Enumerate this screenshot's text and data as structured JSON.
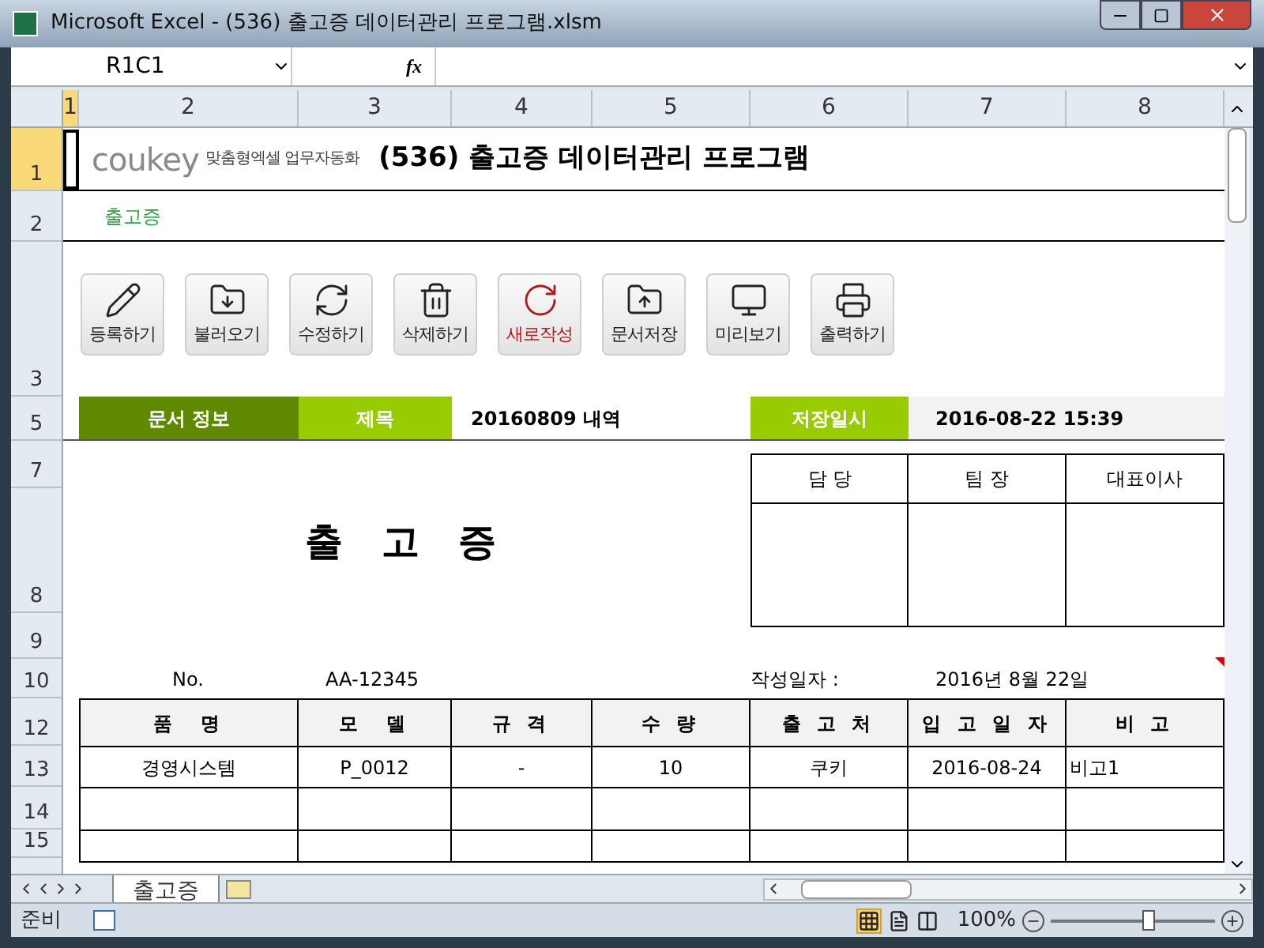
{
  "window": {
    "title": "Microsoft Excel - (536) 출고증 데이터관리 프로그램.xlsm"
  },
  "name_box": "R1C1",
  "formula_label": "fx",
  "column_headers": [
    "1",
    "2",
    "3",
    "4",
    "5",
    "6",
    "7",
    "8"
  ],
  "row_headers": [
    "1",
    "2",
    "3",
    "5",
    "7",
    "8",
    "9",
    "10",
    "12",
    "13",
    "14",
    "15"
  ],
  "header": {
    "brand": "coukey",
    "tagline": "맞춤형엑셀 업무자동화",
    "title": "(536) 출고증 데이터관리 프로그램",
    "subtitle": "출고증"
  },
  "buttons": [
    {
      "label": "등록하기",
      "highlighted": false
    },
    {
      "label": "불러오기",
      "highlighted": false
    },
    {
      "label": "수정하기",
      "highlighted": false
    },
    {
      "label": "삭제하기",
      "highlighted": false
    },
    {
      "label": "새로작성",
      "highlighted": true
    },
    {
      "label": "문서저장",
      "highlighted": false
    },
    {
      "label": "미리보기",
      "highlighted": false
    },
    {
      "label": "출력하기",
      "highlighted": false
    }
  ],
  "info_bar": {
    "section": "문서 정보",
    "title_label": "제목",
    "title_value": "20160809 내역",
    "saved_label": "저장일시",
    "saved_value": "2016-08-22 15:39"
  },
  "form": {
    "heading": "출 고 증",
    "approvals": [
      "담 당",
      "팀 장",
      "대표이사"
    ],
    "no_label": "No.",
    "no_value": "AA-12345",
    "date_label": "작성일자 :",
    "date_value": "2016년 8월 22일"
  },
  "table": {
    "columns": [
      "품　명",
      "모　델",
      "규 격",
      "수 량",
      "출 고 처",
      "입 고 일 자",
      "비 고"
    ],
    "rows": [
      [
        "경영시스템",
        "P_0012",
        "-",
        "10",
        "쿠키",
        "2016-08-24",
        "비고1"
      ]
    ]
  },
  "sheet_tabs": [
    {
      "label": "출고증",
      "selected": true
    }
  ],
  "status_bar": {
    "status": "준비",
    "zoom": "100%",
    "level": 0.6
  }
}
